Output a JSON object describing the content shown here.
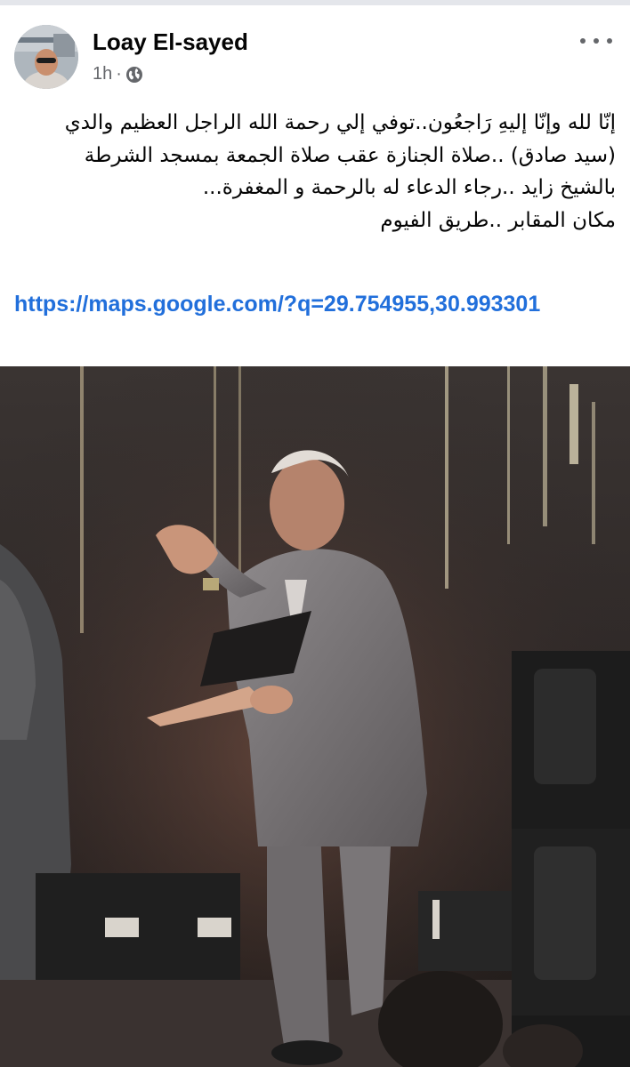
{
  "post": {
    "author_name": "Loay El-sayed",
    "timestamp": "1h",
    "separator": "·",
    "audience_icon": "globe-icon",
    "more_icon": "more-horizontal-icon",
    "text_lines": [
      "إنّا لله وإنّا إليهِ رَاجعُون..توفي إلي رحمة الله الراجل العظيم والدي",
      "(سيد صادق) ..صلاة الجنازة عقب صلاة الجمعة بمسجد الشرطة",
      "بالشيخ زايد ..رجاء الدعاء له بالرحمة و المغفرة...",
      "مكان المقابر ..طريق الفيوم"
    ],
    "link_text": "https://maps.google.com/?q=29.754955,30.993301"
  },
  "colors": {
    "link": "#216fdb",
    "secondary_text": "#65676b",
    "primary_text": "#050505"
  }
}
